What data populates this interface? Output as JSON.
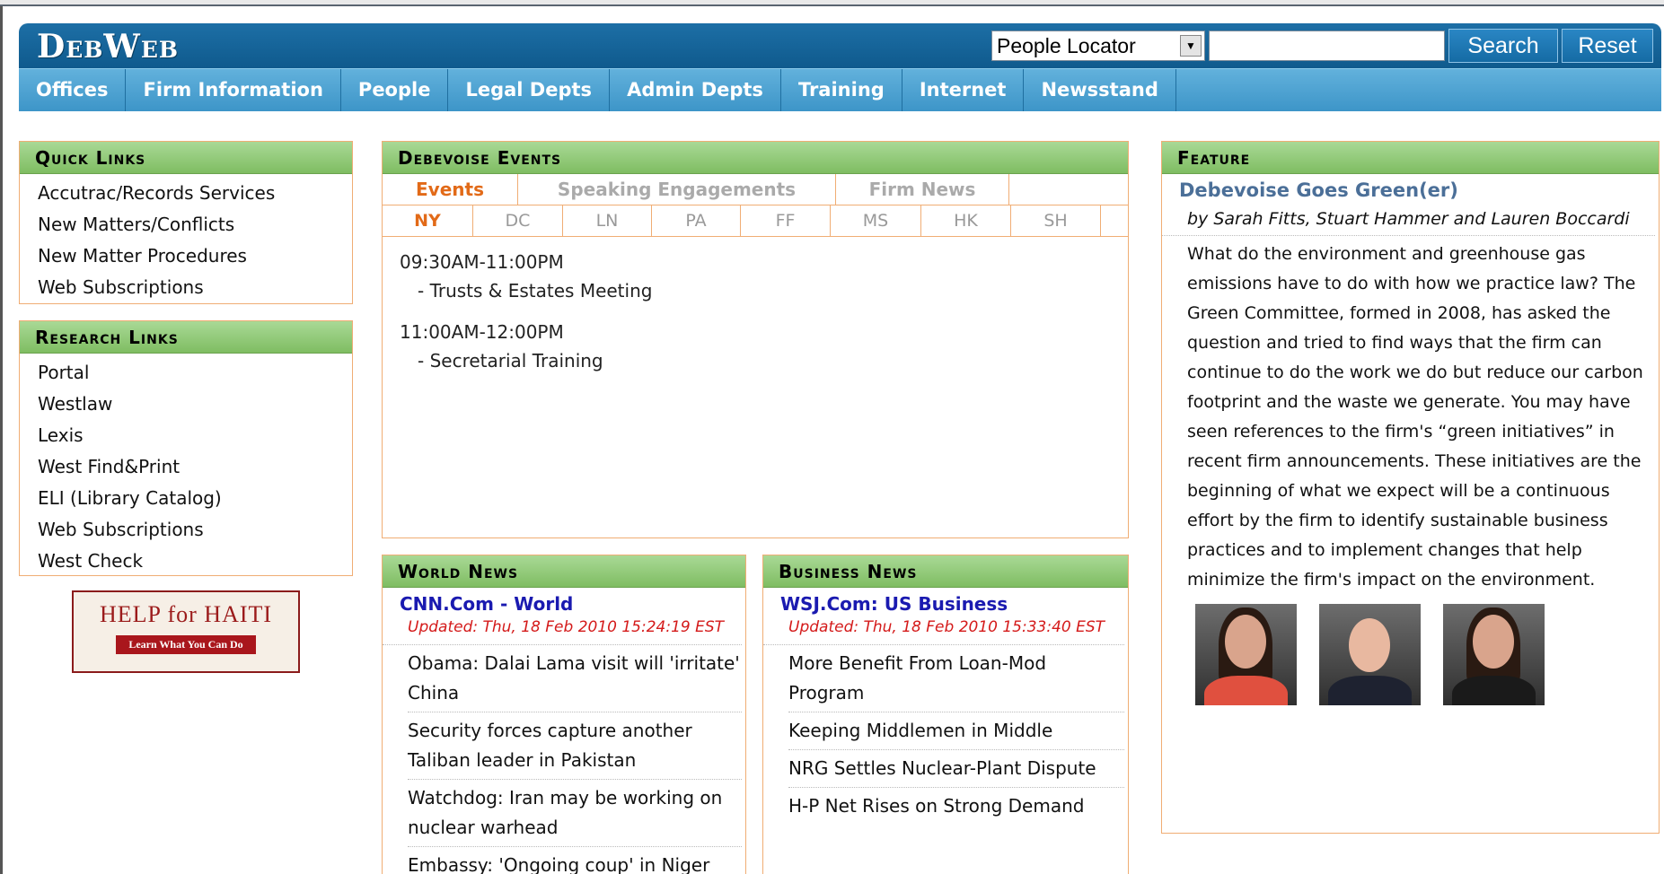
{
  "header": {
    "logo": "DebWeb",
    "locator_selected": "People Locator",
    "search_value": "",
    "search_button": "Search",
    "reset_button": "Reset"
  },
  "nav": {
    "items": [
      "Offices",
      "Firm Information",
      "People",
      "Legal Depts",
      "Admin Depts",
      "Training",
      "Internet",
      "Newsstand"
    ]
  },
  "quick_links": {
    "title": "Quick Links",
    "items": [
      "Accutrac/Records Services",
      "New Matters/Conflicts",
      "New Matter Procedures",
      "Web Subscriptions"
    ]
  },
  "research_links": {
    "title": "Research Links",
    "items": [
      "Portal",
      "Westlaw",
      "Lexis",
      "West Find&Print",
      "ELI (Library Catalog)",
      "Web Subscriptions",
      "West Check"
    ]
  },
  "haiti_banner": {
    "title": "HELP for HAITI",
    "button": "Learn What You Can Do"
  },
  "events": {
    "title": "Debevoise Events",
    "tabs": [
      "Events",
      "Speaking Engagements",
      "Firm News"
    ],
    "offices": [
      "NY",
      "DC",
      "LN",
      "PA",
      "FF",
      "MS",
      "HK",
      "SH"
    ],
    "items": [
      {
        "time": "09:30AM-11:00PM",
        "title": "- Trusts & Estates Meeting"
      },
      {
        "time": "11:00AM-12:00PM",
        "title": "- Secretarial Training"
      }
    ]
  },
  "world_news": {
    "title": "World News",
    "source": "CNN.Com - World",
    "updated": "Updated: Thu, 18 Feb 2010 15:24:19 EST",
    "items": [
      "Obama: Dalai Lama visit will 'irritate' China",
      "Security forces capture another Taliban leader in Pakistan",
      "Watchdog: Iran may be working on nuclear warhead",
      "Embassy: 'Ongoing coup' in Niger"
    ]
  },
  "business_news": {
    "title": "Business News",
    "source": "WSJ.Com: US Business",
    "updated": "Updated: Thu, 18 Feb 2010 15:33:40 EST",
    "items": [
      "More Benefit From Loan-Mod Program",
      "Keeping Middlemen in Middle",
      "NRG Settles Nuclear-Plant Dispute",
      "H-P Net Rises on Strong Demand"
    ]
  },
  "feature": {
    "title": "Feature",
    "headline": "Debevoise Goes Green(er)",
    "byline": "by Sarah Fitts, Stuart Hammer and Lauren Boccardi",
    "body": "What do the environment and greenhouse gas emissions have to do with how we practice law? The Green Committee, formed in 2008, has asked the question and tried to find ways that the firm can continue to do the work we do but reduce our carbon footprint and the waste we generate. You may have seen references to the firm's “green initiatives” in recent firm announcements. These initiatives are the beginning of what we expect will be a continuous effort by the firm to identify sustainable business practices and to implement changes that help minimize the firm's impact on the environment."
  }
}
